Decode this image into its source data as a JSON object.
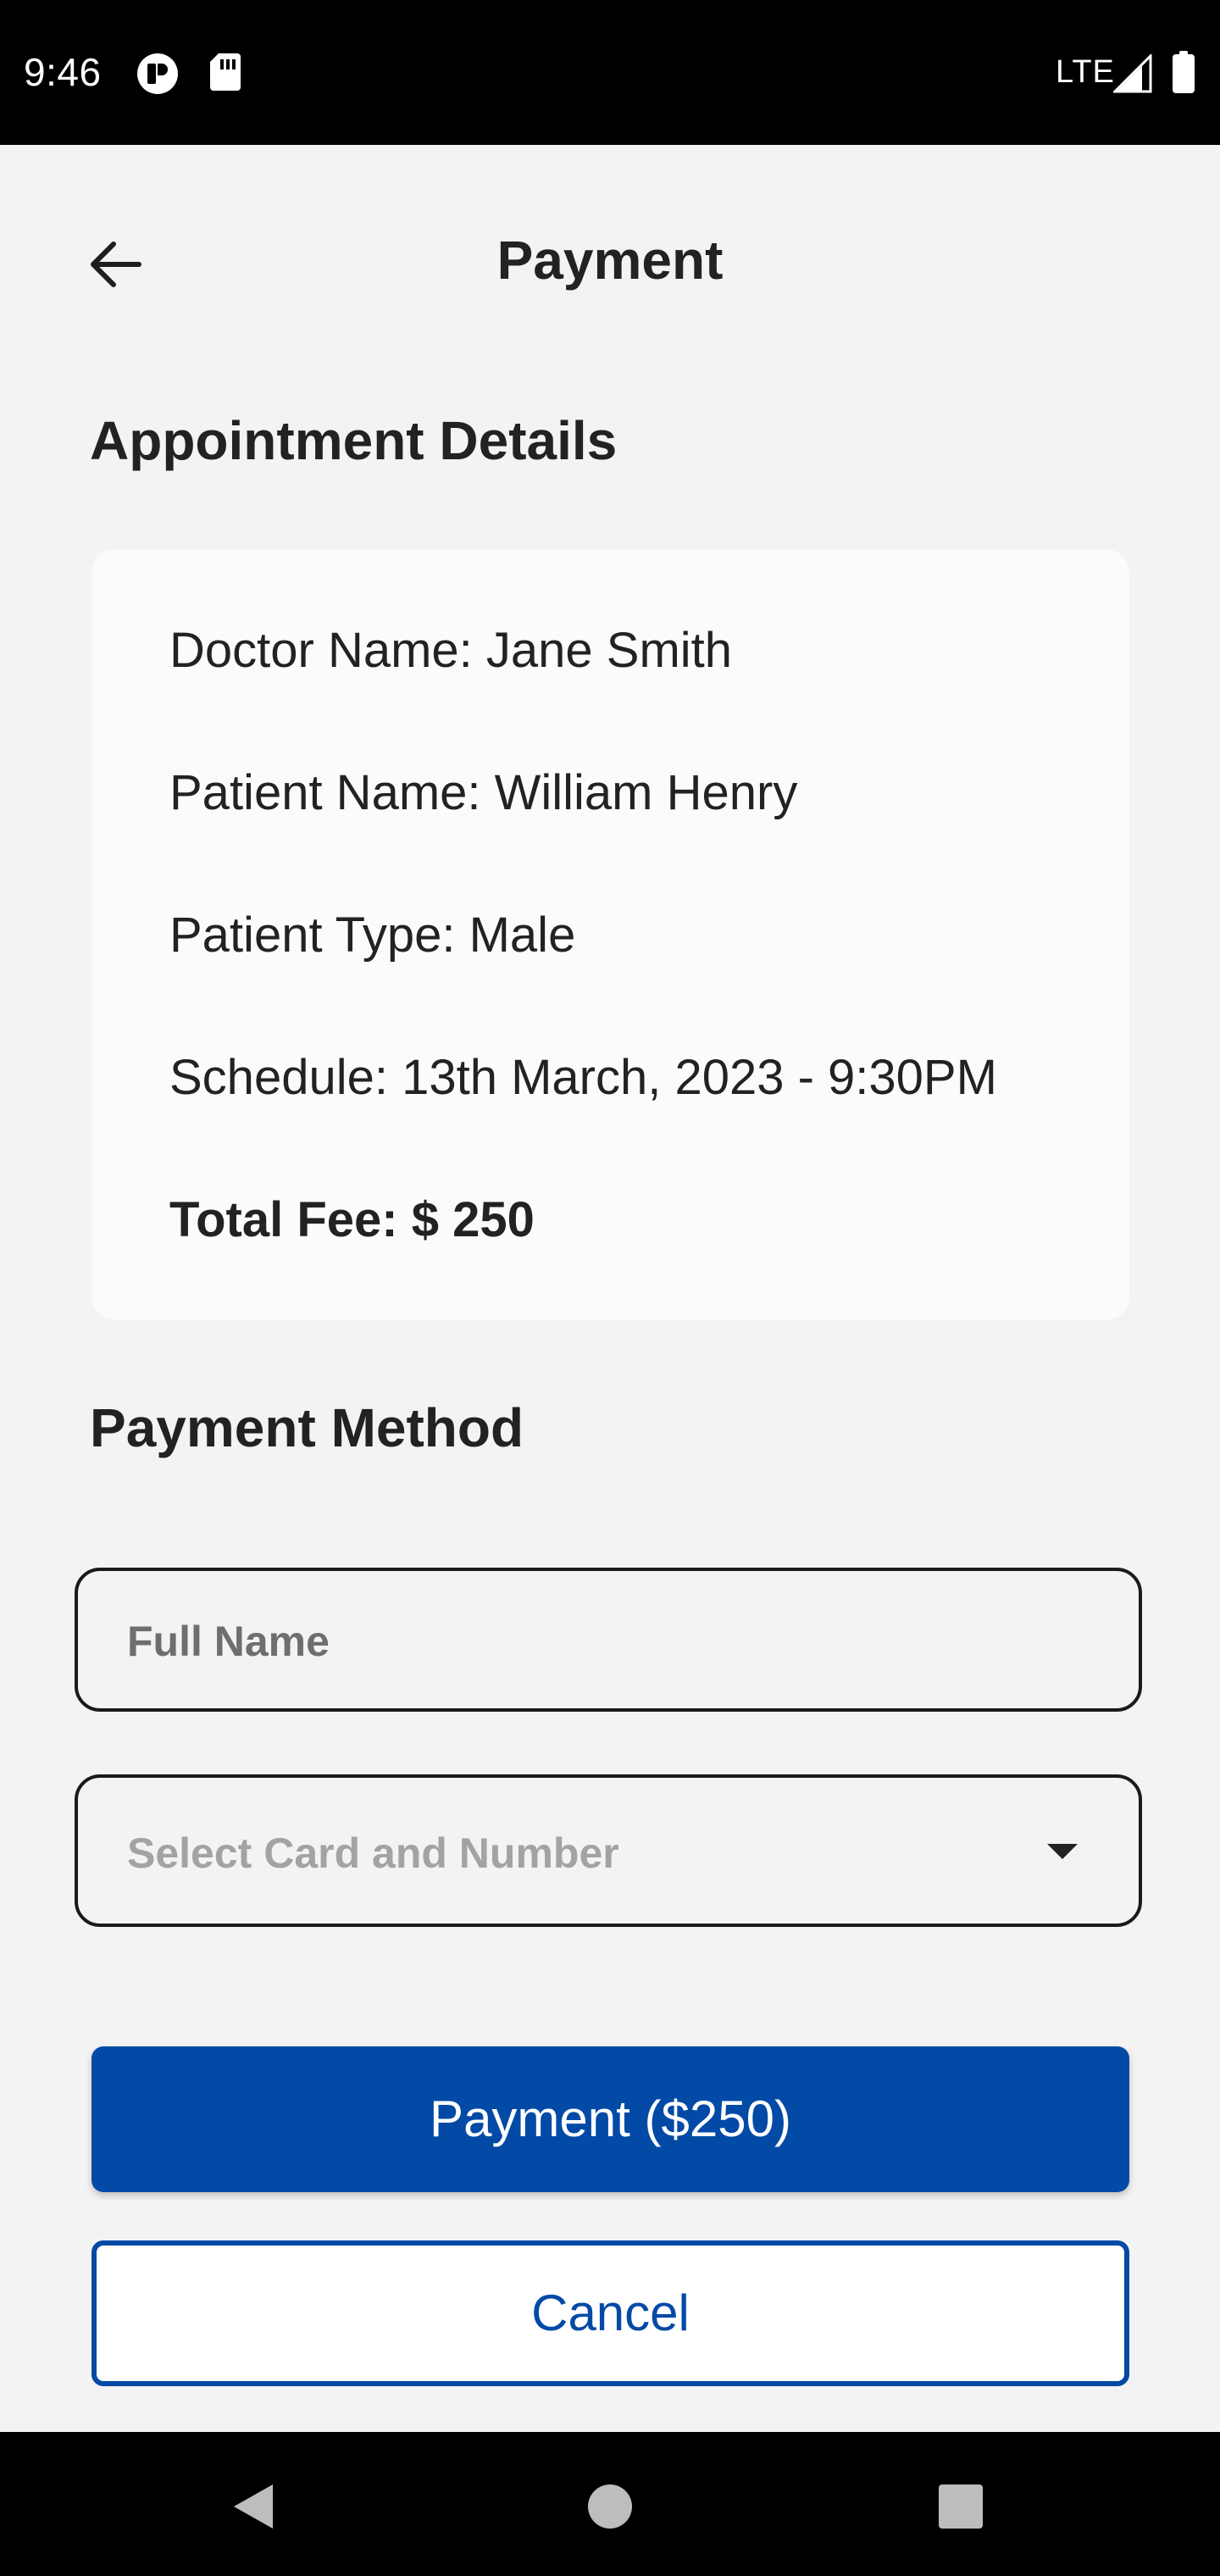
{
  "status_bar": {
    "time": "9:46",
    "network": "LTE"
  },
  "header": {
    "title": "Payment",
    "back_icon": "arrow-left-icon"
  },
  "appointment": {
    "heading": "Appointment Details",
    "doctor": "Doctor Name: Jane Smith",
    "patient": "Patient Name: William Henry",
    "patient_type": "Patient Type: Male",
    "schedule": "Schedule: 13th March, 2023 - 9:30PM",
    "total_fee": "Total Fee: $ 250"
  },
  "payment_method": {
    "heading": "Payment Method",
    "full_name_placeholder": "Full Name",
    "card_select_placeholder": "Select Card and Number"
  },
  "actions": {
    "pay_label": "Payment ($250)",
    "cancel_label": "Cancel"
  },
  "colors": {
    "primary": "#034aa6",
    "background": "#f3f3f3",
    "card": "#fbfbfb"
  }
}
